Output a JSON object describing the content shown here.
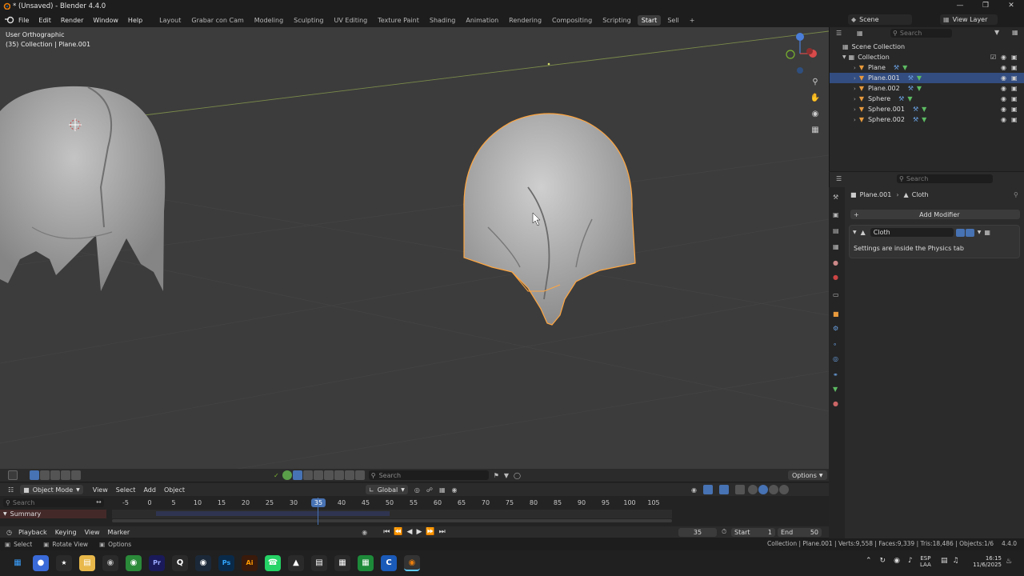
{
  "window": {
    "title": "* (Unsaved) - Blender 4.4.0"
  },
  "menu": {
    "items": [
      "File",
      "Edit",
      "Render",
      "Window",
      "Help"
    ]
  },
  "workspaces": [
    "Layout",
    "Grabar con Cam",
    "Modeling",
    "Sculpting",
    "UV Editing",
    "Texture Paint",
    "Shading",
    "Animation",
    "Rendering",
    "Compositing",
    "Scripting",
    "Start",
    "Sell"
  ],
  "active_workspace": "Start",
  "scene": {
    "label": "Scene",
    "view_layer": "View Layer"
  },
  "viewport": {
    "view_name": "User Orthographic",
    "context": "(35) Collection | Plane.001"
  },
  "viewport_toolbar": {
    "search_placeholder": "Search",
    "options": "Options"
  },
  "header": {
    "mode": "Object Mode",
    "menus": [
      "View",
      "Select",
      "Add",
      "Object"
    ],
    "transform": "Global"
  },
  "timeline": {
    "search_placeholder": "Search",
    "summary": "Summary",
    "ticks": [
      -5,
      0,
      5,
      10,
      15,
      20,
      25,
      30,
      35,
      40,
      45,
      50,
      55,
      60,
      65,
      70,
      75,
      80,
      85,
      90,
      95,
      100,
      105
    ],
    "current_frame": 35,
    "start_label": "Start",
    "start": 1,
    "end_label": "End",
    "end": 50,
    "menus": [
      "Playback",
      "Keying",
      "View",
      "Marker"
    ]
  },
  "outliner": {
    "search_placeholder": "Search",
    "root": "Scene Collection",
    "collection": "Collection",
    "items": [
      {
        "name": "Plane",
        "selected": false
      },
      {
        "name": "Plane.001",
        "selected": true
      },
      {
        "name": "Plane.002",
        "selected": false
      },
      {
        "name": "Sphere",
        "selected": false
      },
      {
        "name": "Sphere.001",
        "selected": false
      },
      {
        "name": "Sphere.002",
        "selected": false
      }
    ]
  },
  "properties": {
    "search_placeholder": "Search",
    "breadcrumb_object": "Plane.001",
    "breadcrumb_modifier": "Cloth",
    "add_modifier": "Add Modifier",
    "modifier_name": "Cloth",
    "modifier_note": "Settings are inside the Physics tab"
  },
  "status": {
    "select": "Select",
    "rotate": "Rotate View",
    "options": "Options",
    "stats": "Collection | Plane.001 | Verts:9,558 | Faces:9,339 | Tris:18,486 | Objects:1/6",
    "version": "4.4.0"
  },
  "taskbar": {
    "lang": "ESP",
    "region": "LAA",
    "time": "16:15",
    "date": "11/6/2025"
  },
  "colors": {
    "accent": "#4772b3",
    "selection": "#ffa640",
    "viewport_bg": "#3c3c3c"
  }
}
